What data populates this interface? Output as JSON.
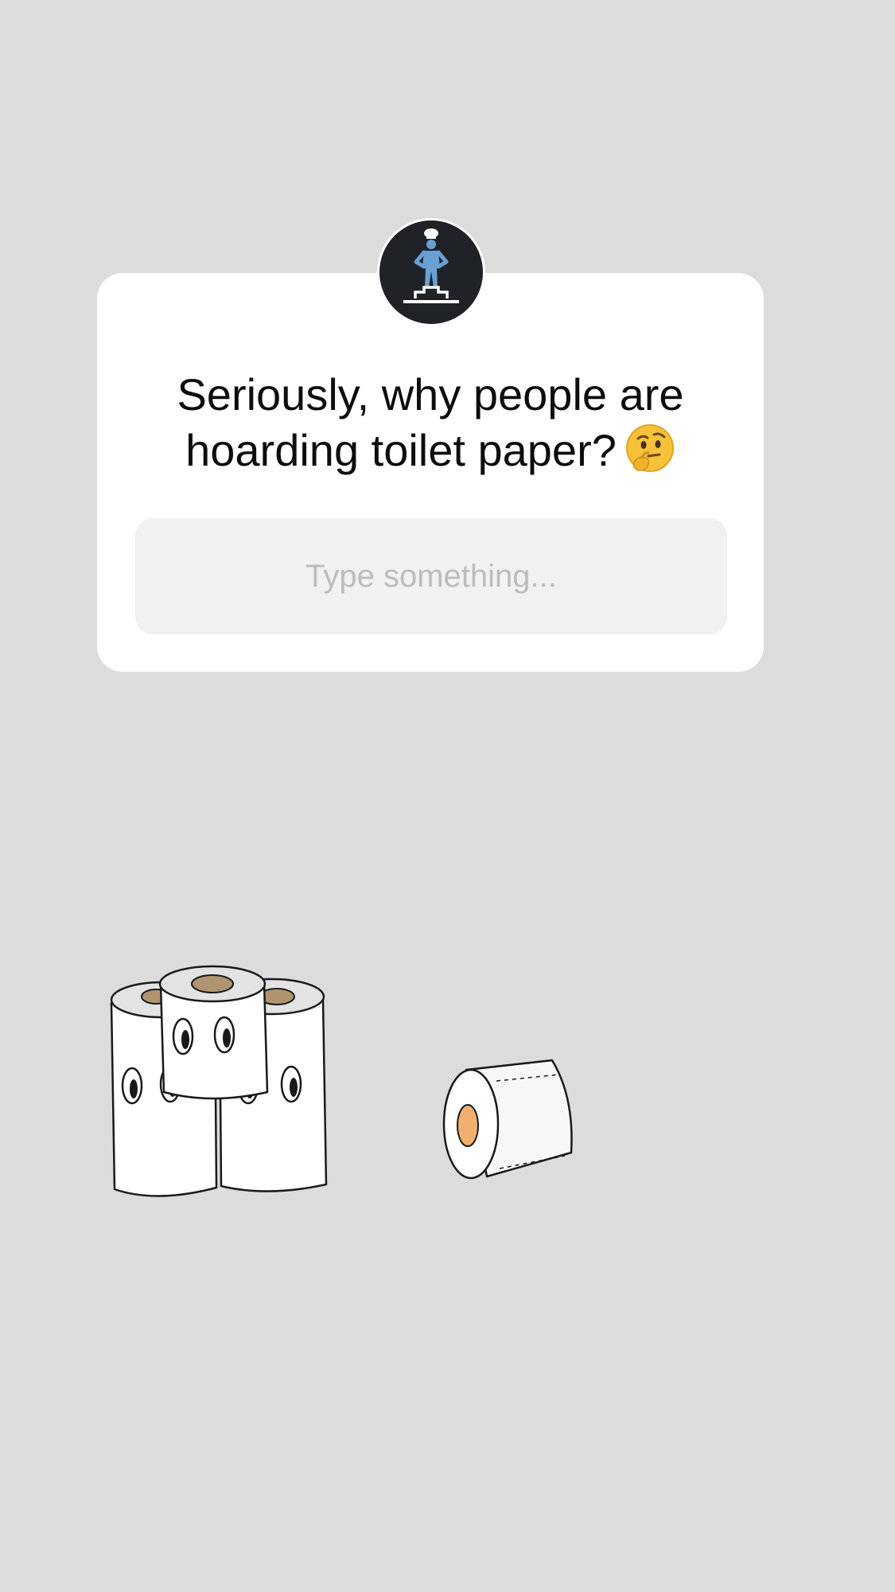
{
  "question_sticker": {
    "question": "Seriously, why people are hoarding toilet paper?",
    "emoji": "thinking-face",
    "answer_placeholder": "Type something...",
    "avatar": "chef-on-podium-icon"
  },
  "stickers": [
    {
      "name": "toilet-paper-stack-sticker"
    },
    {
      "name": "toilet-paper-roll-sticker"
    }
  ],
  "colors": {
    "background": "#dcdcdc",
    "card": "#ffffff",
    "input_bg": "#f1f1f1",
    "avatar_bg": "#1f2328",
    "avatar_figure": "#6a9fd4"
  }
}
